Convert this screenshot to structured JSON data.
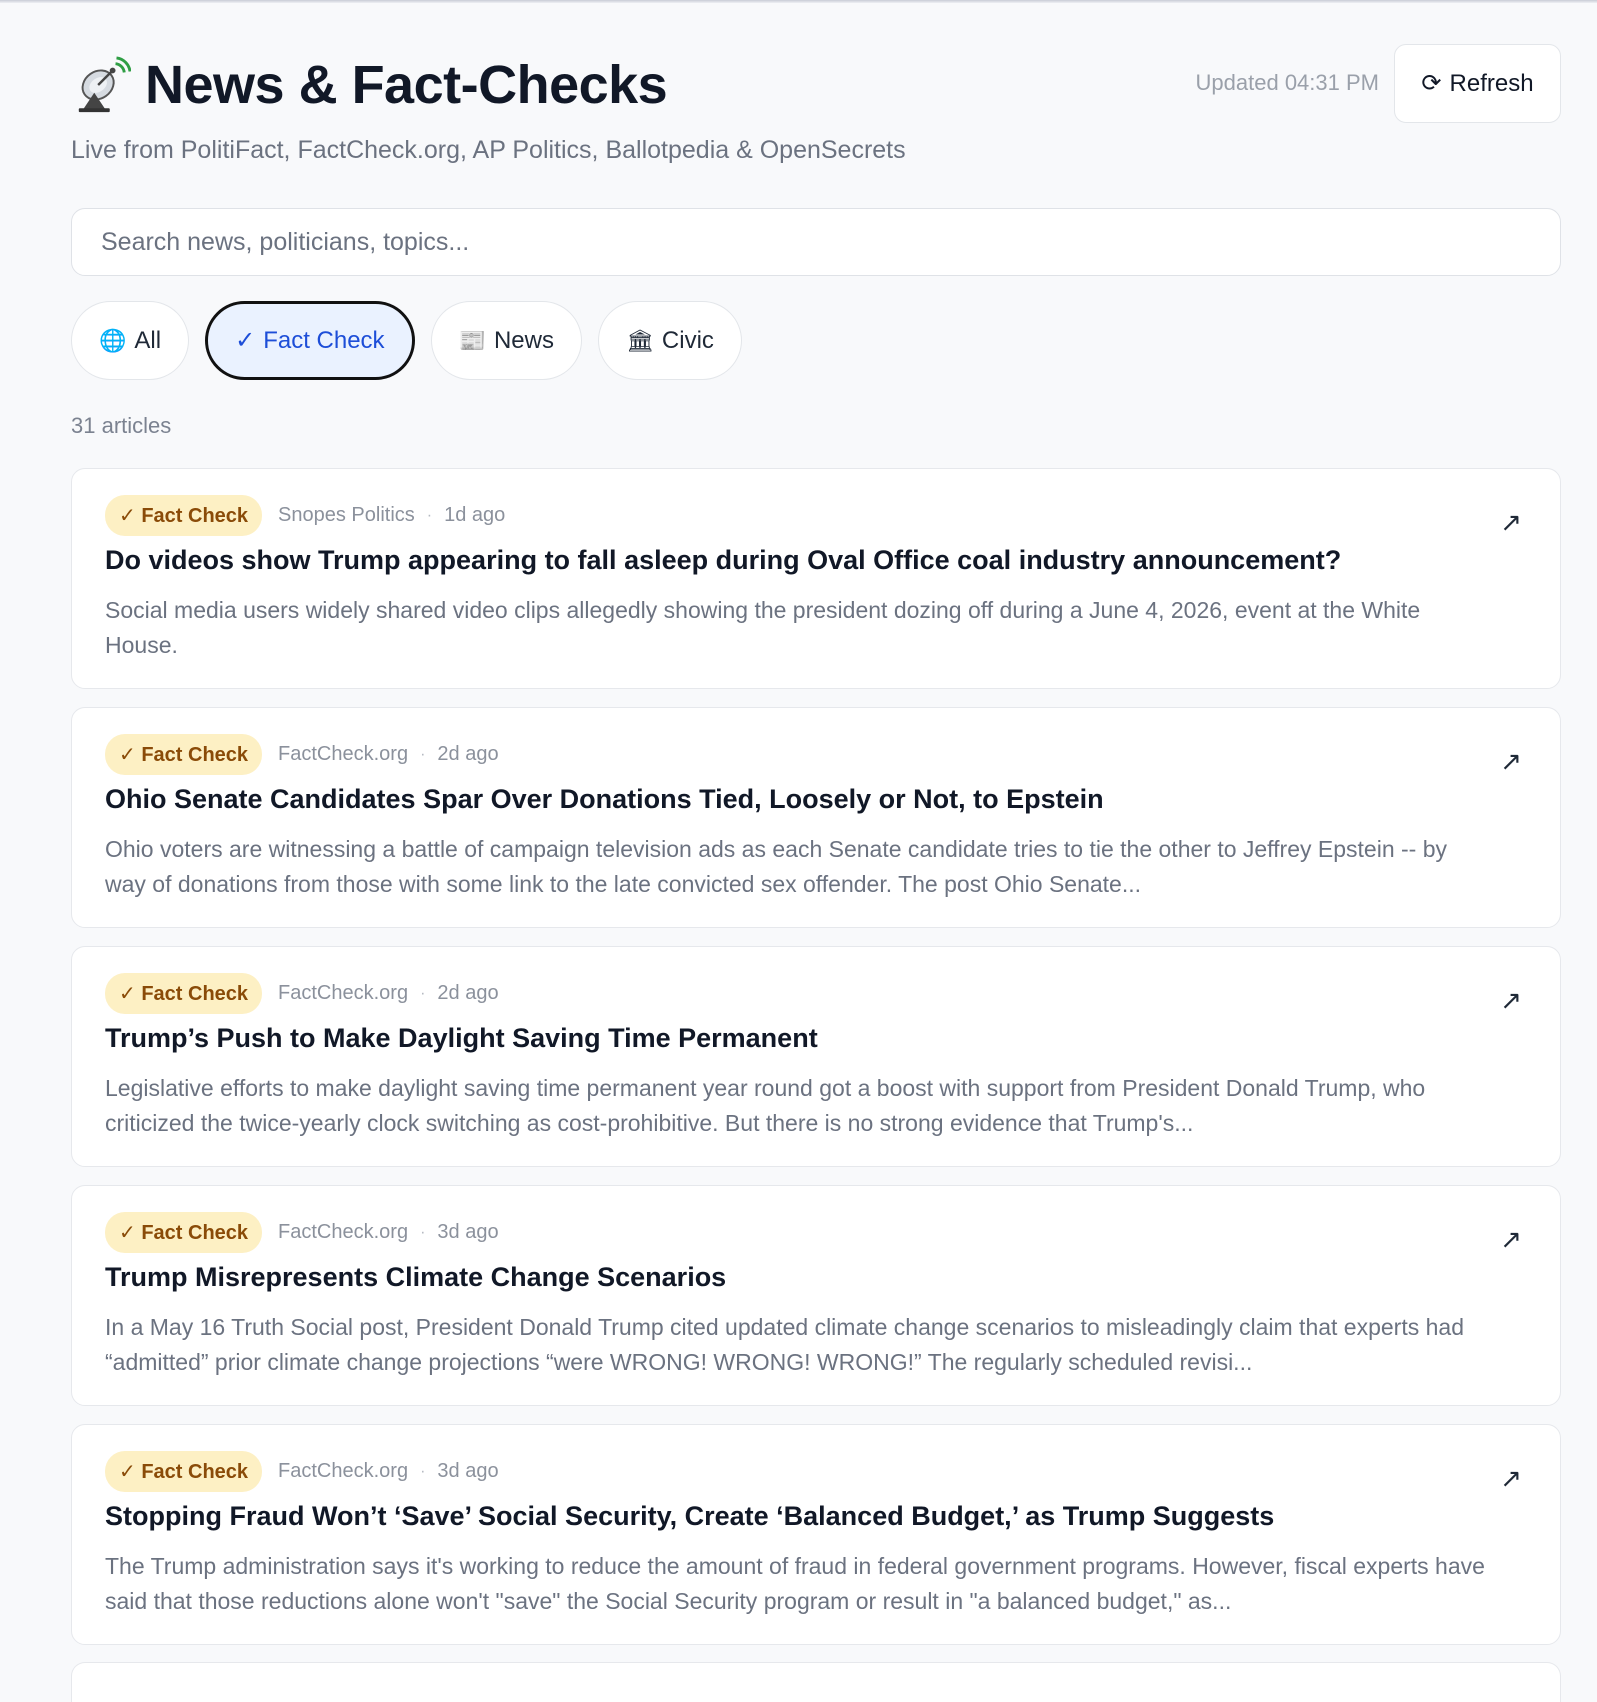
{
  "header": {
    "title": "News & Fact-Checks",
    "updated": "Updated 04:31 PM",
    "refresh_label": "Refresh",
    "subtitle": "Live from PolitiFact, FactCheck.org, AP Politics, Ballotpedia & OpenSecrets"
  },
  "search": {
    "placeholder": "Search news, politicians, topics..."
  },
  "filters": [
    {
      "icon": "🌐",
      "label": "All",
      "active": false
    },
    {
      "icon": "✓",
      "label": "Fact Check",
      "active": true
    },
    {
      "icon": "📰",
      "label": "News",
      "active": false
    },
    {
      "icon": "🏛",
      "label": "Civic",
      "active": false
    }
  ],
  "count_label": "31 articles",
  "articles": [
    {
      "badge": "✓ Fact Check",
      "source": "Snopes Politics",
      "time": "1d ago",
      "title": "Do videos show Trump appearing to fall asleep during Oval Office coal industry announcement?",
      "summary": "Social media users widely shared video clips allegedly showing the president dozing off during a June 4, 2026, event at the White House."
    },
    {
      "badge": "✓ Fact Check",
      "source": "FactCheck.org",
      "time": "2d ago",
      "title": "Ohio Senate Candidates Spar Over Donations Tied, Loosely or Not, to Epstein",
      "summary": "Ohio voters are witnessing a battle of campaign television ads as each Senate candidate tries to tie the other to Jeffrey Epstein -- by way of donations from those with some link to the late convicted sex offender. The post Ohio Senate..."
    },
    {
      "badge": "✓ Fact Check",
      "source": "FactCheck.org",
      "time": "2d ago",
      "title": "Trump’s Push to Make Daylight Saving Time Permanent",
      "summary": "Legislative efforts to make daylight saving time permanent year round got a boost with support from President Donald Trump, who criticized the twice-yearly clock switching as cost-prohibitive. But there is no strong evidence that Trump's..."
    },
    {
      "badge": "✓ Fact Check",
      "source": "FactCheck.org",
      "time": "3d ago",
      "title": "Trump Misrepresents Climate Change Scenarios",
      "summary": "In a May 16 Truth Social post, President Donald Trump cited updated climate change scenarios to misleadingly claim that experts had “admitted” prior climate change projections “were WRONG! WRONG! WRONG!” The regularly scheduled revisi..."
    },
    {
      "badge": "✓ Fact Check",
      "source": "FactCheck.org",
      "time": "3d ago",
      "title": "Stopping Fraud Won’t ‘Save’ Social Security, Create ‘Balanced Budget,’ as Trump Suggests",
      "summary": "The Trump administration says it's working to reduce the amount of fraud in federal government programs. However, fiscal experts have said that those reductions alone won't \"save\" the Social Security program or result in \"a balanced budget,\" as..."
    }
  ],
  "icons": {
    "logo": "satellite-antenna-icon",
    "refresh": "refresh-icon",
    "external": "external-link-icon"
  },
  "colors": {
    "accent_blue": "#1d4ed8",
    "badge_bg": "#fdf0c4",
    "badge_text": "#8a4b08"
  }
}
